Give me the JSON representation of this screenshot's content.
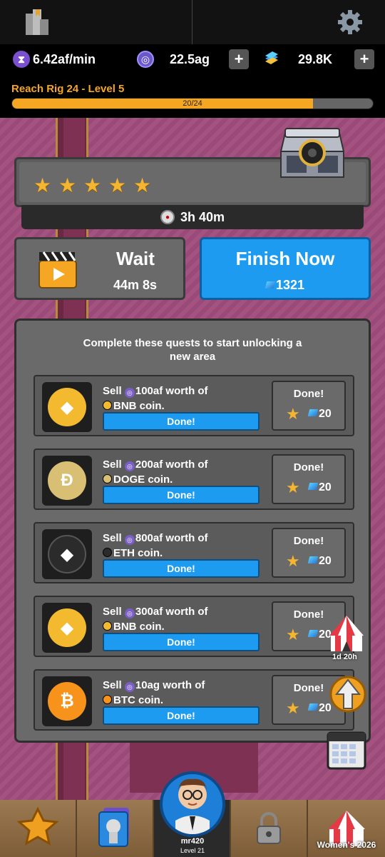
{
  "top": {
    "icons": {
      "left": "rankings-icon",
      "right": "gear-icon"
    }
  },
  "stats": {
    "rate": "6.42af/min",
    "currency_ag": "22.5ag",
    "gems": "29.8K",
    "plus": "+"
  },
  "goal": {
    "title": "Reach Rig 24 - Level 5",
    "progress_text": "20/24",
    "progress_fraction": 0.8333
  },
  "stars": {
    "count": 5,
    "symbol": "★"
  },
  "timer": "3h 40m",
  "wait": {
    "title": "Wait",
    "time": "44m 8s"
  },
  "finish": {
    "title": "Finish Now",
    "cost": "1321"
  },
  "quests": {
    "header": "Complete these quests to start unlocking a new area",
    "items": [
      {
        "pre": "Sell ",
        "amount": "100af",
        "mid": " worth of",
        "coin": "BNB coin.",
        "status": "Done!",
        "reward_label": "Done!",
        "reward": "20",
        "coin_color": "#f3ba2f",
        "coin_symbol": "◆"
      },
      {
        "pre": "Sell ",
        "amount": "200af",
        "mid": " worth of",
        "coin": "DOGE coin.",
        "status": "Done!",
        "reward_label": "Done!",
        "reward": "20",
        "coin_color": "#d9bf73",
        "coin_symbol": "Ð"
      },
      {
        "pre": "Sell ",
        "amount": "800af",
        "mid": " worth of",
        "coin": "ETH coin.",
        "status": "Done!",
        "reward_label": "Done!",
        "reward": "20",
        "coin_color": "#2b2b2b",
        "coin_symbol": "◆"
      },
      {
        "pre": "Sell ",
        "amount": "300af",
        "mid": " worth of",
        "coin": "BNB coin.",
        "status": "Done!",
        "reward_label": "Done!",
        "reward": "20",
        "coin_color": "#f3ba2f",
        "coin_symbol": "◆"
      },
      {
        "pre": "Sell ",
        "amount": "10ag",
        "mid": " worth of",
        "coin": "BTC coin.",
        "status": "Done!",
        "reward_label": "Done!",
        "reward": "20",
        "coin_color": "#f7931a",
        "coin_symbol": "₿"
      }
    ]
  },
  "side": {
    "event_timer": "1d 20h"
  },
  "nav": {
    "profile_name": "mr420",
    "profile_level": "Level 21",
    "event_label": "Women's 2026"
  },
  "colors": {
    "accent_orange": "#f5a623",
    "finish_blue": "#1d9bf0",
    "star_gold": "#f5b52e"
  }
}
